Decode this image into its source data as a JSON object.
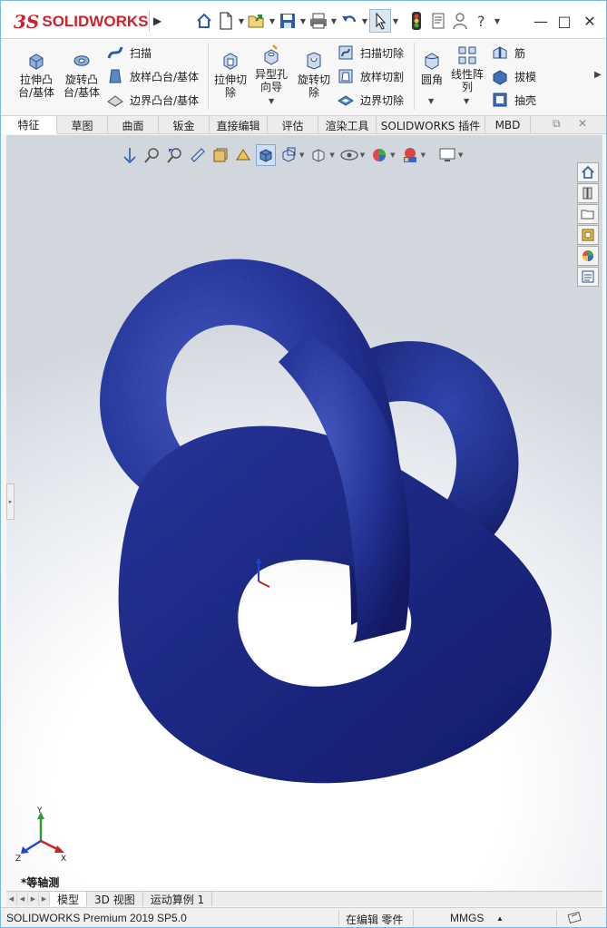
{
  "app": {
    "logo_ds": "3S",
    "logo_text": "SOLIDWORKS",
    "expand_glyph": "▶"
  },
  "quick_access": [
    {
      "icon": "home-icon"
    },
    {
      "icon": "new-document-icon"
    },
    {
      "icon": "open-file-icon"
    },
    {
      "icon": "save-icon"
    },
    {
      "icon": "print-icon"
    },
    {
      "icon": "undo-icon"
    },
    {
      "icon": "select-arrow-icon"
    },
    {
      "icon": "rebuild-traffic-light-icon"
    },
    {
      "icon": "file-properties-icon"
    },
    {
      "icon": "user-icon"
    },
    {
      "icon": "help-icon"
    }
  ],
  "window_controls": {
    "minimize": "—",
    "maximize": "□",
    "close": "✕"
  },
  "ribbon": {
    "extrude_boss": "拉伸凸\n台/基体",
    "revolve_boss": "旋转凸\n台/基体",
    "sweep": "扫描",
    "loft_boss": "放样凸台/基体",
    "boundary_boss": "边界凸台/基体",
    "extrude_cut": "拉伸切\n除",
    "hole_wizard": "异型孔\n向导",
    "revolve_cut": "旋转切\n除",
    "swept_cut": "扫描切除",
    "lofted_cut": "放样切割",
    "boundary_cut": "边界切除",
    "fillet": "圆角",
    "linear_pattern": "线性阵\n列",
    "rib": "筋",
    "draft": "拔模",
    "shell": "抽壳"
  },
  "tabs": [
    {
      "label": "特征",
      "active": true
    },
    {
      "label": "草图",
      "active": false
    },
    {
      "label": "曲面",
      "active": false
    },
    {
      "label": "钣金",
      "active": false
    },
    {
      "label": "直接编辑",
      "active": false
    },
    {
      "label": "评估",
      "active": false
    },
    {
      "label": "渲染工具",
      "active": false
    },
    {
      "label": "SOLIDWORKS 插件",
      "active": false
    },
    {
      "label": "MBD",
      "active": false
    }
  ],
  "tab_window_controls": {
    "restore": "⧉",
    "close": "✕"
  },
  "view_name": "*等轴测",
  "bottom_tabs": [
    {
      "label": "模型",
      "active": true
    },
    {
      "label": "3D 视图",
      "active": false
    },
    {
      "label": "运动算例 1",
      "active": false
    }
  ],
  "status": {
    "product": "SOLIDWORKS Premium 2019 SP5.0",
    "mode": "在编辑 零件",
    "units": "MMGS",
    "units_drop": "▲"
  },
  "triad": {
    "x": "X",
    "y": "Y",
    "z": "Z"
  },
  "colors": {
    "brand_red": "#d0202a",
    "model_blue": "#2f3fa8",
    "selection_blue": "#cde0f5"
  }
}
